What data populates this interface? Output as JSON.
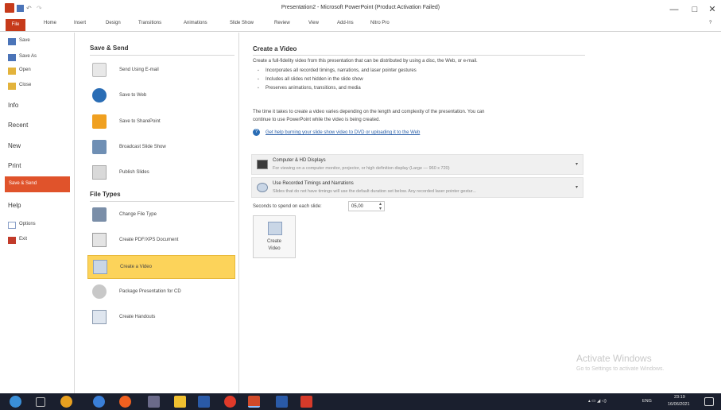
{
  "window": {
    "title": "Presentation2 - Microsoft PowerPoint (Product Activation Failed)",
    "minimize": "—",
    "restore": "□",
    "close": "✕",
    "help": "?"
  },
  "ribbon": {
    "file": "File",
    "tabs": [
      "Home",
      "Insert",
      "Design",
      "Transitions",
      "Animations",
      "Slide Show",
      "Review",
      "View",
      "Add-Ins",
      "Nitro Pro"
    ]
  },
  "leftnav": {
    "save": "Save",
    "save_as": "Save As",
    "open": "Open",
    "close": "Close",
    "info": "Info",
    "recent": "Recent",
    "new": "New",
    "print": "Print",
    "save_send": "Save & Send",
    "help": "Help",
    "options": "Options",
    "exit": "Exit"
  },
  "middle": {
    "save_send_heading": "Save & Send",
    "items": [
      "Send Using E-mail",
      "Save to Web",
      "Save to SharePoint",
      "Broadcast Slide Show",
      "Publish Slides"
    ],
    "file_types_heading": "File Types",
    "file_items": [
      "Change File Type",
      "Create PDF/XPS Document",
      "Create a Video",
      "Package Presentation for CD",
      "Create Handouts"
    ]
  },
  "content": {
    "heading": "Create a Video",
    "intro": "Create a full-fidelity video from this presentation that can be distributed by using a disc, the Web, or e-mail.",
    "bullets": [
      "Incorporates all recorded timings, narrations, and laser pointer gestures",
      "Includes all slides not hidden in the slide show",
      "Preserves animations, transitions, and media"
    ],
    "time_note_1": "The time it takes to create a video varies depending on the length and complexity of the presentation. You can",
    "time_note_2": "continue to use PowerPoint while the video is being created.",
    "help_link": "Get help burning your slide show video to DVD or uploading it to the Web",
    "quality": {
      "title": "Computer & HD Displays",
      "desc": "For viewing on a computer monitor, projector, or high definition display  (Large — 960 x 720)"
    },
    "timings": {
      "title": "Use Recorded Timings and Narrations",
      "desc": "Slides that do not have timings will use the default duration set below. Any recorded laser pointer gestur..."
    },
    "seconds_label": "Seconds to spend on each slide:",
    "seconds_value": "05,00",
    "create_button_line1": "Create",
    "create_button_line2": "Video"
  },
  "watermark": {
    "line1": "Activate Windows",
    "line2": "Go to Settings to activate Windows."
  },
  "tray": {
    "lang": "ENG",
    "time": "23:19",
    "date": "16/06/2021"
  },
  "colors": {
    "file_tab": "#c63a1a",
    "nav_selected": "#e0532b",
    "item_selected": "#fcd35a",
    "taskbar": "#1a1f2e"
  }
}
